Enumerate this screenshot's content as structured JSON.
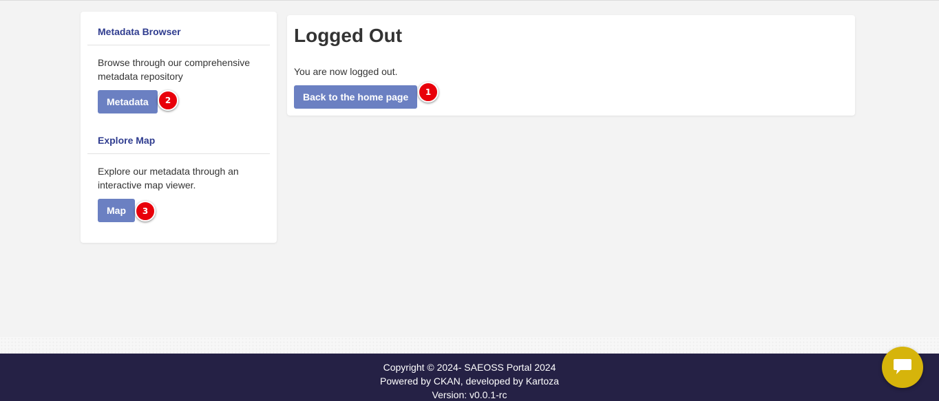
{
  "sidebar": {
    "metadata_section": {
      "title": "Metadata Browser",
      "description": "Browse through our comprehensive metadata repository",
      "button_label": "Metadata",
      "badge": "2"
    },
    "map_section": {
      "title": "Explore Map",
      "description": "Explore our metadata through an interactive map viewer.",
      "button_label": "Map",
      "badge": "3"
    }
  },
  "main": {
    "title": "Logged Out",
    "message": "You are now logged out.",
    "button_label": "Back to the home page",
    "badge": "1"
  },
  "footer": {
    "copyright": "Copyright © 2024- SAEOSS Portal 2024",
    "powered_by": "Powered by CKAN, developed by Kartoza",
    "version": "Version: v0.0.1-rc"
  },
  "chat": {
    "icon": "chat-bubble-icon"
  },
  "colors": {
    "accent_title": "#2f3c8f",
    "button": "#6b80c2",
    "badge": "#e8000a",
    "footer_bg": "#252145",
    "chat_bg": "#d6b40b"
  }
}
